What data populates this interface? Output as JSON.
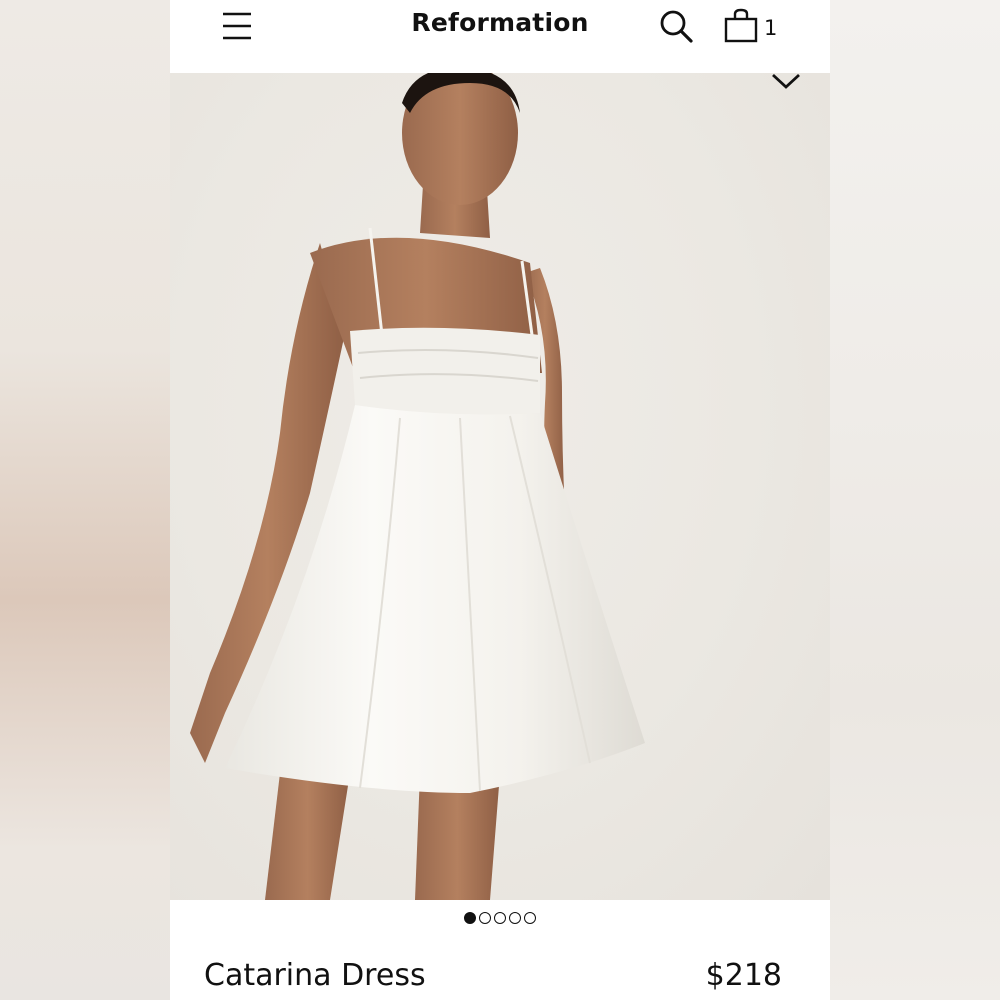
{
  "header": {
    "brand": "Reformation",
    "menu_icon": "hamburger-menu-icon",
    "search_icon": "search-icon",
    "bag_icon": "shopping-bag-icon",
    "bag_count": "1"
  },
  "gallery": {
    "collapse_icon": "chevron-down-icon",
    "image": "model wearing white mini dress",
    "slide_count": 5,
    "active_slide": 1
  },
  "product": {
    "name": "Catarina Dress",
    "price": "$218"
  },
  "colors": {
    "text": "#111111",
    "background": "#ffffff",
    "photo_backdrop": "#ebe8e2",
    "dress": "#f7f6f2",
    "skin": "#a8765a"
  }
}
